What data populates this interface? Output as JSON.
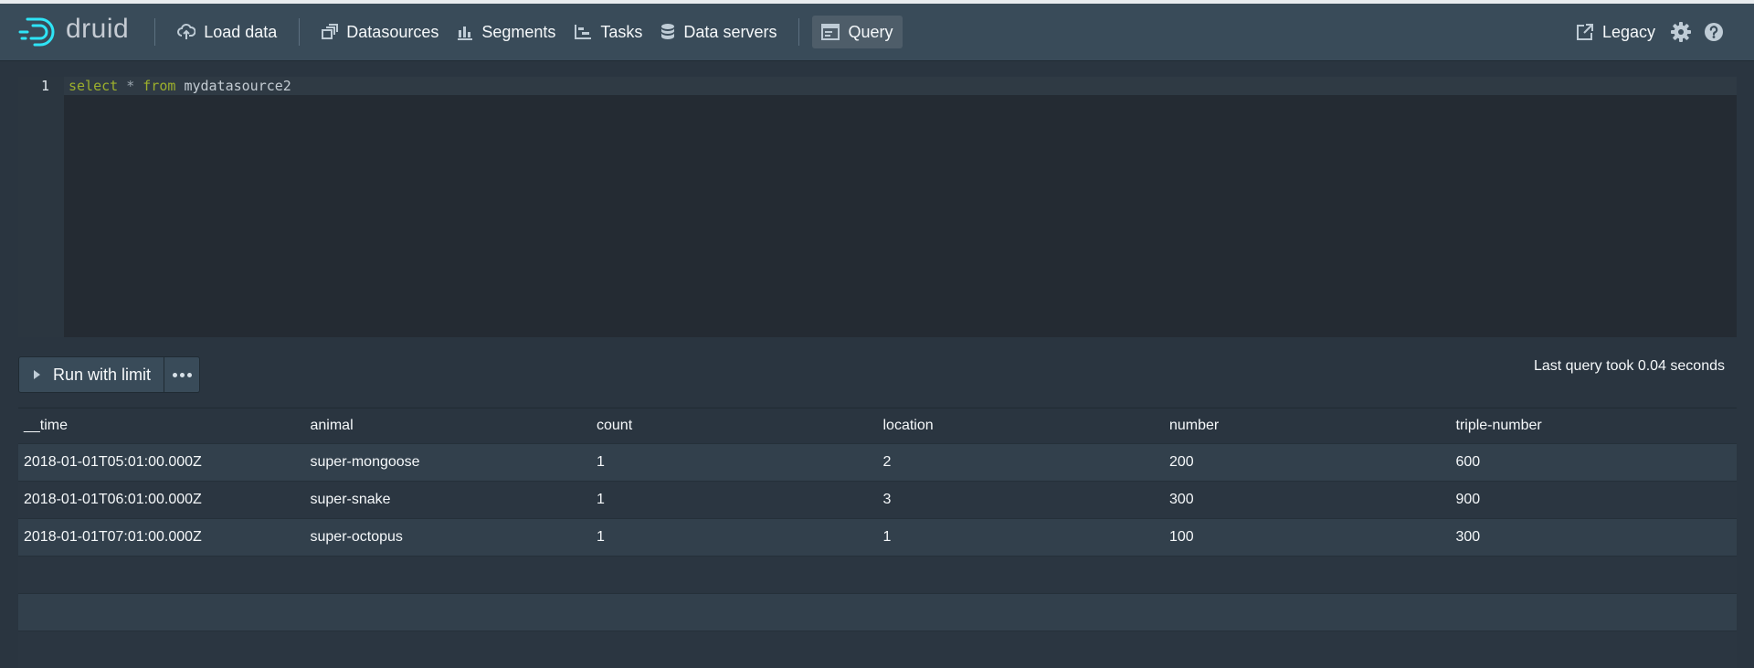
{
  "app": {
    "logo_text": "druid",
    "accent_color": "#2ee4f6"
  },
  "nav": {
    "items": [
      {
        "label": "Load data",
        "icon": "cloud-upload-icon"
      },
      {
        "label": "Datasources",
        "icon": "multi-select-icon"
      },
      {
        "label": "Segments",
        "icon": "stacked-chart-icon"
      },
      {
        "label": "Tasks",
        "icon": "gantt-chart-icon"
      },
      {
        "label": "Data servers",
        "icon": "database-icon"
      },
      {
        "label": "Query",
        "icon": "application-icon",
        "active": true
      }
    ],
    "legacy_label": "Legacy"
  },
  "editor": {
    "line_number": "1",
    "code": {
      "kw1": "select",
      "op": "*",
      "kw2": "from",
      "ident": "mydatasource2"
    }
  },
  "toolbar": {
    "run_label": "Run with limit",
    "query_time": "Last query took 0.04 seconds"
  },
  "results": {
    "columns": [
      "__time",
      "animal",
      "count",
      "location",
      "number",
      "triple-number"
    ],
    "rows": [
      [
        "2018-01-01T05:01:00.000Z",
        "super-mongoose",
        "1",
        "2",
        "200",
        "600"
      ],
      [
        "2018-01-01T06:01:00.000Z",
        "super-snake",
        "1",
        "3",
        "300",
        "900"
      ],
      [
        "2018-01-01T07:01:00.000Z",
        "super-octopus",
        "1",
        "1",
        "100",
        "300"
      ]
    ]
  }
}
